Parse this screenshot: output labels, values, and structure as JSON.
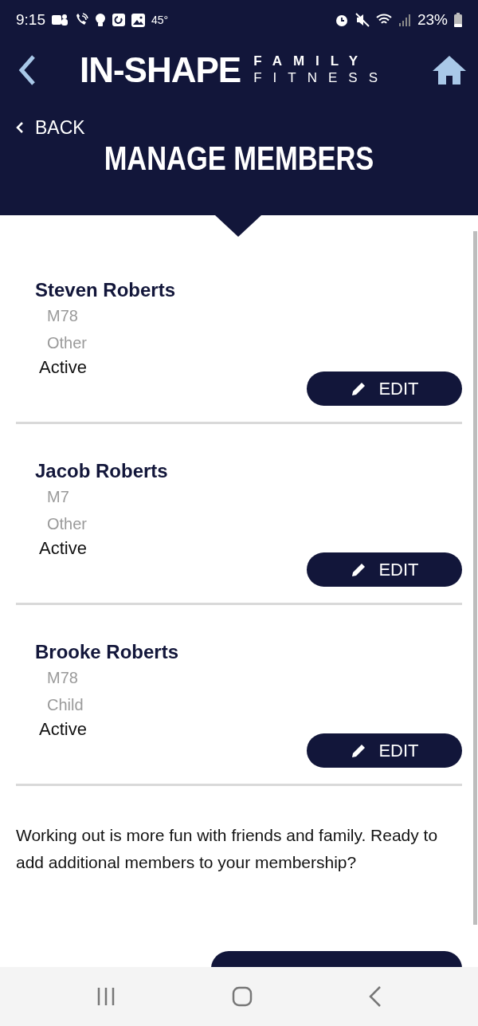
{
  "status_bar": {
    "time": "9:15",
    "temperature": "45°",
    "battery": "23%"
  },
  "logo": {
    "main": "IN-SHAPE",
    "line_1": "FAMILY",
    "line_2": "FITNESS"
  },
  "back_link": "BACK",
  "title": "MANAGE MEMBERS",
  "members": [
    {
      "name": "Steven Roberts",
      "id": "M78",
      "type": "Other",
      "status": "Active",
      "button": "EDIT"
    },
    {
      "name": "Jacob Roberts",
      "id": "M7",
      "type": "Other",
      "status": "Active",
      "button": "EDIT"
    },
    {
      "name": "Brooke Roberts",
      "id": "M78",
      "type": "Child",
      "status": "Active",
      "button": "EDIT"
    }
  ],
  "invite_text": "Working out is more fun with friends and family. Ready to add additional members to your membership?"
}
